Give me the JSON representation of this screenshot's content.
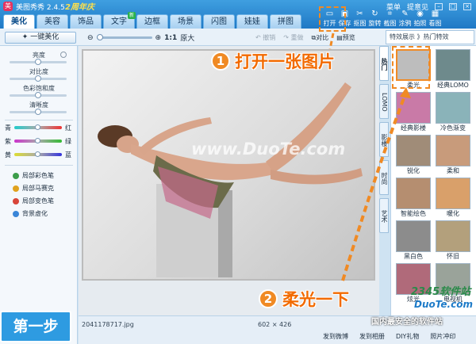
{
  "app": {
    "title": "美图秀秀 2.4.5",
    "promo": "2周年庆",
    "menu": "菜单",
    "feedback": "提意见"
  },
  "tabs": [
    {
      "label": "美化",
      "active": true
    },
    {
      "label": "美容"
    },
    {
      "label": "饰品"
    },
    {
      "label": "文字",
      "badge": "新"
    },
    {
      "label": "边框"
    },
    {
      "label": "场景"
    },
    {
      "label": "闪图"
    },
    {
      "label": "娃娃"
    },
    {
      "label": "拼图"
    }
  ],
  "tools": [
    {
      "label": "打开",
      "icon": "folder-icon"
    },
    {
      "label": "保存",
      "icon": "save-icon"
    },
    {
      "label": "抠图",
      "icon": "cutout-icon"
    },
    {
      "label": "旋转",
      "icon": "rotate-icon"
    },
    {
      "label": "截图",
      "icon": "screenshot-icon"
    },
    {
      "label": "涂鸦",
      "icon": "brush-icon"
    },
    {
      "label": "拍照",
      "icon": "camera-icon"
    },
    {
      "label": "看图",
      "icon": "view-icon"
    }
  ],
  "toolbar": {
    "auto_beautify": "一键美化",
    "zoom_ratio": "1:1",
    "zoom_original": "原大",
    "undo": "撤销",
    "redo": "重做",
    "compare": "对比",
    "preview": "预览"
  },
  "effects_header": "特效展示 》热门特效",
  "sliders": {
    "brightness": "亮度",
    "contrast": "对比度",
    "saturation": "色彩饱和度",
    "sharpness": "清晰度"
  },
  "color_balance": [
    {
      "left": "青",
      "right": "红"
    },
    {
      "left": "紫",
      "right": "绿"
    },
    {
      "left": "黄",
      "right": "蓝"
    }
  ],
  "left_tools": [
    {
      "label": "局部彩色笔",
      "color": "#3c9d4a"
    },
    {
      "label": "局部马赛克",
      "color": "#e0a21e"
    },
    {
      "label": "局部变色笔",
      "color": "#d8453a"
    },
    {
      "label": "背景虚化",
      "color": "#3a86d8"
    }
  ],
  "step_badge": "第一步",
  "canvas_watermark": "www.DuoTe.com",
  "vertical_tabs": [
    "热门",
    "LOMO",
    "影楼",
    "时尚",
    "艺术",
    "其他"
  ],
  "effects": [
    {
      "label": "柔光",
      "selected": true,
      "tone": "#bdbdbd"
    },
    {
      "label": "经典LOMO",
      "tone": "#6e8a8c"
    },
    {
      "label": "经典影楼",
      "tone": "#c97aa7"
    },
    {
      "label": "冷色渐变",
      "tone": "#8ab3b9"
    },
    {
      "label": "锐化",
      "tone": "#a08c78"
    },
    {
      "label": "柔和",
      "tone": "#c89b7b"
    },
    {
      "label": "智能绘色",
      "tone": "#b58e70"
    },
    {
      "label": "暖化",
      "tone": "#d9a06a"
    },
    {
      "label": "黑白色",
      "tone": "#8c8c8c"
    },
    {
      "label": "怀旧",
      "tone": "#b3a07c"
    },
    {
      "label": "炫光",
      "tone": "#b06a7a"
    },
    {
      "label": "电视机",
      "tone": "#9aa39a"
    }
  ],
  "status": {
    "filename": "2041178717.jpg",
    "dims": "602 × 426",
    "share": [
      "发到微博",
      "发到相册",
      "DIY礼物",
      "照片冲印"
    ]
  },
  "callouts": {
    "one_num": "1",
    "one_text": "打开一张图片",
    "two_num": "2",
    "two_text": "柔光一下"
  },
  "corner_brand": {
    "name": "2345软件站",
    "site": "DuoTe.com",
    "tagline": "国内最安全的软件站"
  }
}
